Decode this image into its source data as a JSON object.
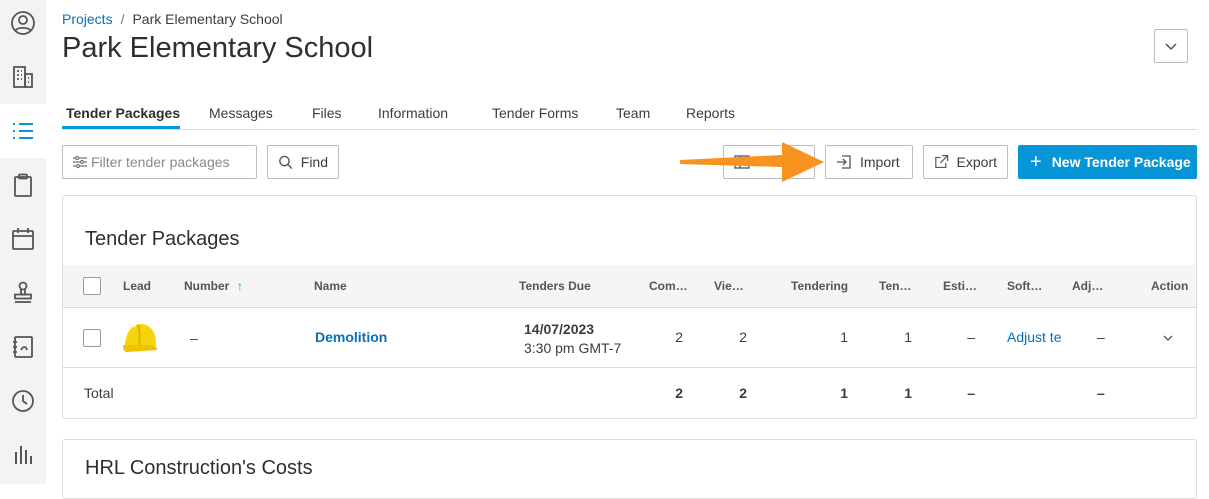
{
  "breadcrumb": {
    "projects_link": "Projects",
    "separator": "/",
    "current": "Park Elementary School"
  },
  "page_title": "Park Elementary School",
  "tabs": [
    {
      "label": "Tender Packages",
      "active": true
    },
    {
      "label": "Messages"
    },
    {
      "label": "Files"
    },
    {
      "label": "Information"
    },
    {
      "label": "Tender Forms"
    },
    {
      "label": "Team"
    },
    {
      "label": "Reports"
    }
  ],
  "toolbar": {
    "filter_placeholder": "Filter tender packages",
    "find_label": "Find",
    "columns_label": "",
    "import_label": "Import",
    "export_label": "Export",
    "new_package_label": "New Tender Package",
    "accent_color": "#0696d7",
    "annotation_arrow_color": "#f7931e"
  },
  "tender_packages": {
    "title": "Tender Packages",
    "columns": {
      "lead": "Lead",
      "number": "Number",
      "number_sort": "↑",
      "name": "Name",
      "tenders_due": "Tenders Due",
      "committed": "Com…",
      "viewed": "Vie…",
      "tendering": "Tendering",
      "tendered": "Ten…",
      "estimate": "Esti…",
      "software": "Soft…",
      "adjusted": "Adj…",
      "action": "Action"
    },
    "rows": [
      {
        "lead_icon": "hard-hat-icon",
        "number": "–",
        "name": "Demolition",
        "due_date": "14/07/2023",
        "due_time": "3:30 pm GMT-7",
        "committed": "2",
        "viewed": "2",
        "tendering": "1",
        "tendered": "1",
        "estimate": "–",
        "software": "Adjust te",
        "adjusted": "–"
      }
    ],
    "total": {
      "label": "Total",
      "committed": "2",
      "viewed": "2",
      "tendering": "1",
      "tendered": "1",
      "estimate": "–",
      "adjusted": "–"
    }
  },
  "costs_card": {
    "title": "HRL Construction's Costs"
  }
}
